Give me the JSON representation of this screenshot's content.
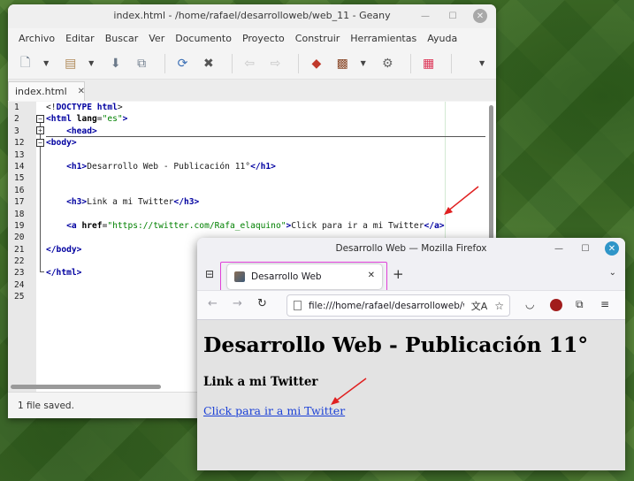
{
  "geany": {
    "title": "index.html - /home/rafael/desarrolloweb/web_11 - Geany",
    "menu": [
      "Archivo",
      "Editar",
      "Buscar",
      "Ver",
      "Documento",
      "Proyecto",
      "Construir",
      "Herramientas",
      "Ayuda"
    ],
    "tab": {
      "label": "index.html"
    },
    "line_numbers": [
      "1",
      "2",
      "3",
      "12",
      "13",
      "14",
      "15",
      "16",
      "17",
      "18",
      "19",
      "20",
      "21",
      "22",
      "23",
      "24",
      "25"
    ],
    "code": {
      "l1_doctype_open": "<!",
      "l1_doctype_kw": "DOCTYPE",
      "l1_doctype_rest": " html",
      "l1_close": ">",
      "l2_tag": "<html",
      "l2_attr": " lang",
      "l2_eq": "=",
      "l2_str": "\"es\"",
      "l2_close": ">",
      "l3_tag": "<head>",
      "l12_tag": "<body>",
      "l14_open": "<h1>",
      "l14_text": "Desarrollo Web - Publicación 11°",
      "l14_close": "</h1>",
      "l17_open": "<h3>",
      "l17_text": "Link a mi Twitter",
      "l17_close": "</h3>",
      "l19_open": "<a",
      "l19_attr": " href",
      "l19_eq": "=",
      "l19_str": "\"https://twitter.com/Rafa_elaquino\"",
      "l19_gt": ">",
      "l19_text": "Click para ir a mi Twitter",
      "l19_close": "</a>",
      "l21_tag": "</body>",
      "l23_tag": "</html>"
    },
    "status": "1 file saved."
  },
  "firefox": {
    "title": "Desarrollo Web — Mozilla Firefox",
    "tab_label": "Desarrollo Web",
    "url": "file:///home/rafael/desarrolloweb/w",
    "page": {
      "h1": "Desarrollo Web - Publicación 11°",
      "h3": "Link a mi Twitter",
      "link": "Click para ir a mi Twitter"
    }
  },
  "colors": {
    "annotation_arrow": "#e02020",
    "tab_highlight": "#e040d8",
    "html_tag": "#0000a0",
    "html_string": "#008000",
    "link": "#1a3fd6"
  },
  "icons": [
    "new-file-icon",
    "open-file-icon",
    "save-icon",
    "save-all-icon",
    "reload-icon",
    "close-file-icon",
    "navigate-back-icon",
    "navigate-forward-icon",
    "compile-icon",
    "build-icon",
    "execute-icon",
    "color-chooser-icon",
    "list-all-tabs-icon",
    "back-arrow-icon",
    "forward-arrow-icon",
    "reload-icon",
    "translate-icon",
    "bookmark-star-icon",
    "pocket-icon",
    "ublock-icon",
    "extensions-icon",
    "hamburger-menu-icon"
  ]
}
